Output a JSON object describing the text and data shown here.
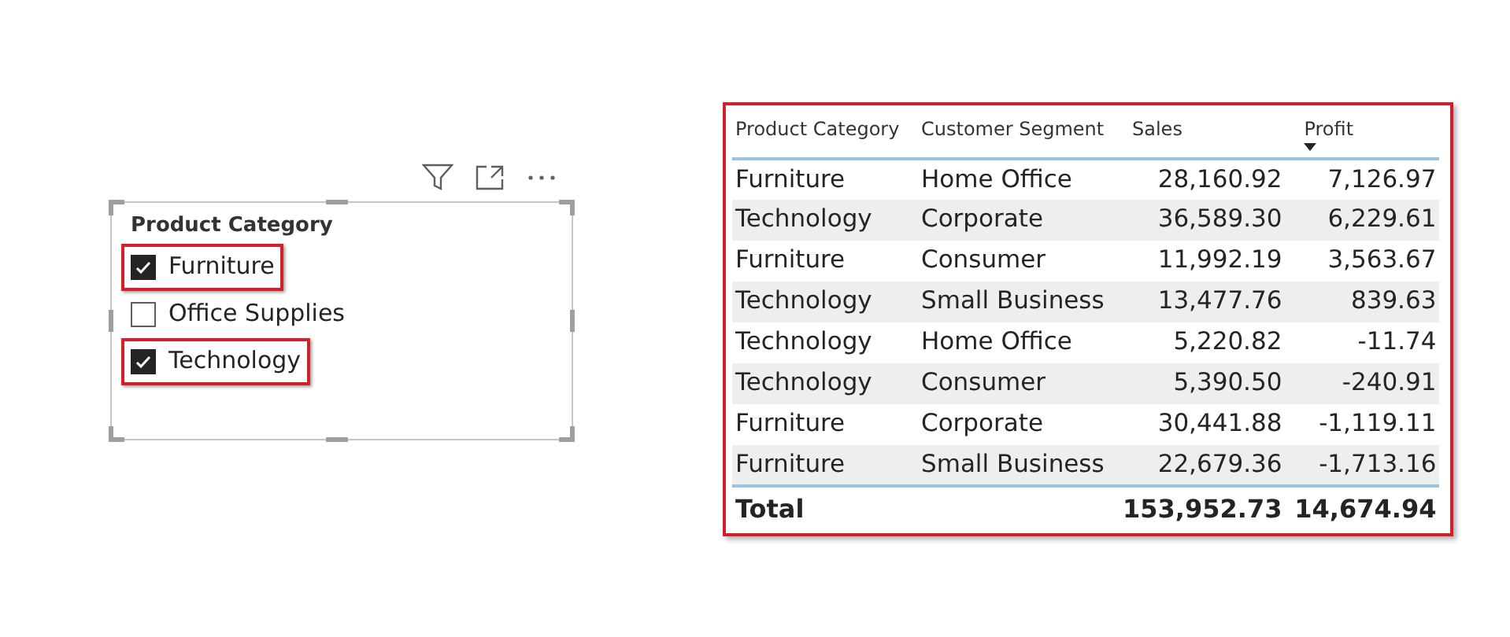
{
  "slicer": {
    "title": "Product Category",
    "items": [
      {
        "label": "Furniture",
        "checked": true,
        "highlighted": true
      },
      {
        "label": "Office Supplies",
        "checked": false,
        "highlighted": false
      },
      {
        "label": "Technology",
        "checked": true,
        "highlighted": true
      }
    ]
  },
  "table": {
    "columns": [
      {
        "label": "Product Category",
        "sorted": false
      },
      {
        "label": "Customer Segment",
        "sorted": false
      },
      {
        "label": "Sales",
        "sorted": false
      },
      {
        "label": "Profit",
        "sorted": true
      }
    ],
    "rows": [
      [
        "Furniture",
        "Home Office",
        "28,160.92",
        "7,126.97"
      ],
      [
        "Technology",
        "Corporate",
        "36,589.30",
        "6,229.61"
      ],
      [
        "Furniture",
        "Consumer",
        "11,992.19",
        "3,563.67"
      ],
      [
        "Technology",
        "Small Business",
        "13,477.76",
        "839.63"
      ],
      [
        "Technology",
        "Home Office",
        "5,220.82",
        "-11.74"
      ],
      [
        "Technology",
        "Consumer",
        "5,390.50",
        "-240.91"
      ],
      [
        "Furniture",
        "Corporate",
        "30,441.88",
        "-1,119.11"
      ],
      [
        "Furniture",
        "Small Business",
        "22,679.36",
        "-1,713.16"
      ]
    ],
    "total": {
      "label": "Total",
      "sales": "153,952.73",
      "profit": "14,674.94"
    }
  }
}
